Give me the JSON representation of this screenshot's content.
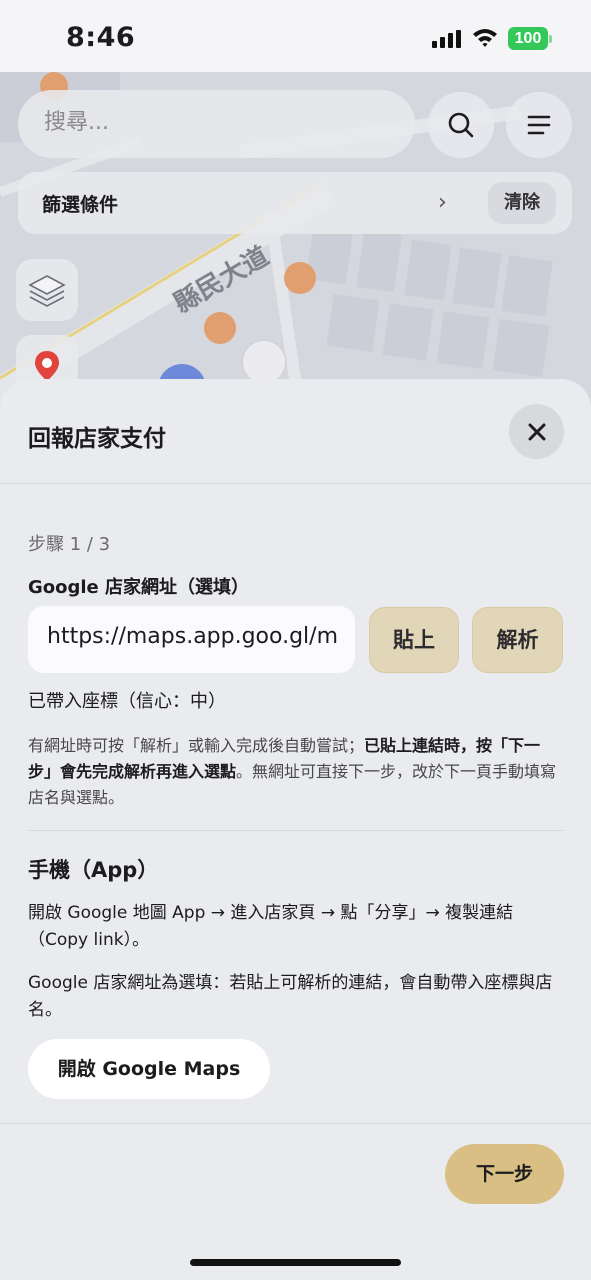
{
  "status_bar": {
    "time": "8:46",
    "battery": "100"
  },
  "map": {
    "search": {
      "placeholder": "搜尋..."
    },
    "filter": {
      "label": "篩選條件",
      "clear_label": "清除"
    },
    "road_label": "縣民大道"
  },
  "sheet": {
    "title": "回報店家支付",
    "step": "步驟 1 / 3",
    "url_label": "Google 店家網址（選填）",
    "url_value": "https://maps.app.goo.gl/m",
    "paste_label": "貼上",
    "parse_label": "解析",
    "coord_status": "已帶入座標（信心：中）",
    "help": {
      "part1": "有網址時可按「解析」或輸入完成後自動嘗試；",
      "bold": "已貼上連結時，按「下一步」會先完成解析再進入選點",
      "part2": "。無網址可直接下一步，改於下一頁手動填寫店名與選點。"
    },
    "mobile_title": "手機（App）",
    "mobile_instructions": "開啟 Google 地圖 App → 進入店家頁 → 點「分享」→ 複製連結（Copy link）。",
    "optional_note": "Google 店家網址為選填：若貼上可解析的連結，會自動帶入座標與店名。",
    "open_maps_label": "開啟 Google Maps",
    "next_label": "下一步"
  },
  "colors": {
    "accent": "#d9bf83",
    "tan_button": "#e2d6b9",
    "battery": "#34c759",
    "poi": "#e07b2e"
  }
}
